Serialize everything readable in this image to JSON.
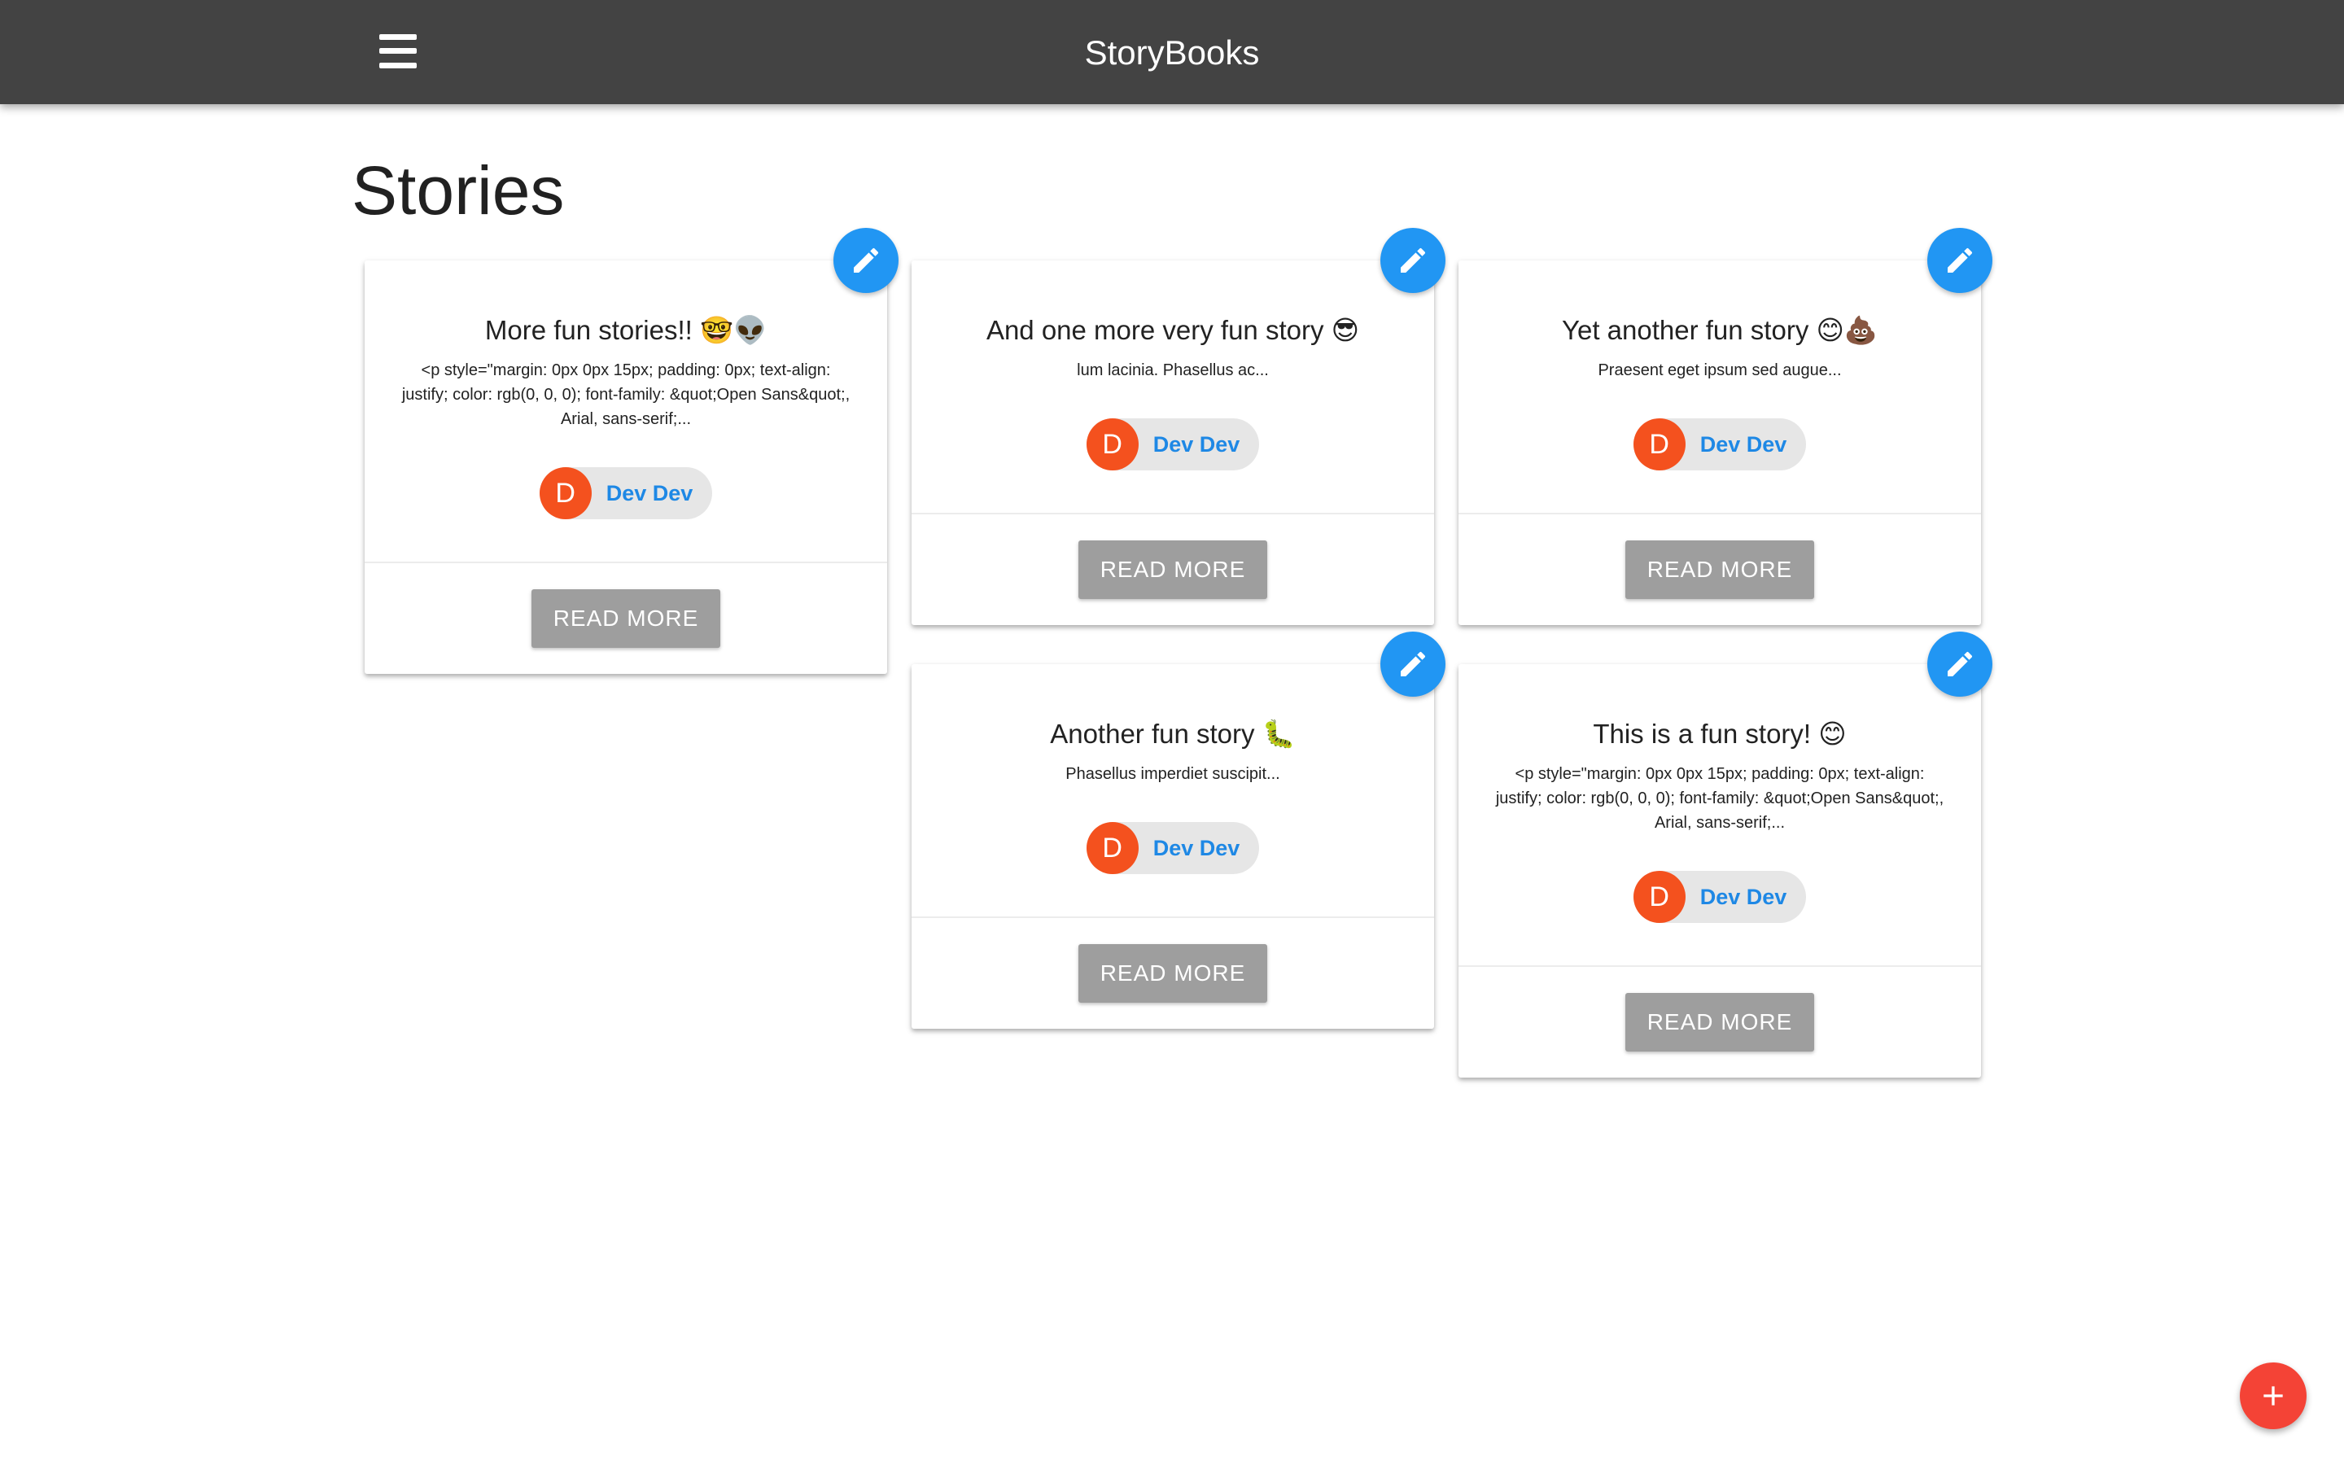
{
  "header": {
    "brand": "StoryBooks",
    "menu_icon": "hamburger-menu-icon"
  },
  "page": {
    "title": "Stories"
  },
  "stories": [
    {
      "title": "More fun stories!! 🤓👽",
      "excerpt": "<p style=\"margin: 0px 0px 15px; padding: 0px; text-align: justify; color: rgb(0, 0, 0); font-family: &quot;Open Sans&quot;, Arial, sans-serif;...",
      "author_initial": "D",
      "author_name": "Dev Dev",
      "read_more_label": "READ MORE",
      "edit_icon": "edit-icon"
    },
    {
      "title": "And one more very fun story 😎",
      "excerpt": "lum lacinia. Phasellus ac...",
      "author_initial": "D",
      "author_name": "Dev Dev",
      "read_more_label": "READ MORE",
      "edit_icon": "edit-icon"
    },
    {
      "title": "Yet another fun story 😊💩",
      "excerpt": "Praesent eget ipsum sed augue...",
      "author_initial": "D",
      "author_name": "Dev Dev",
      "read_more_label": "READ MORE",
      "edit_icon": "edit-icon"
    },
    {
      "title": "Another fun story 🐛",
      "excerpt": "Phasellus imperdiet suscipit...",
      "author_initial": "D",
      "author_name": "Dev Dev",
      "read_more_label": "READ MORE",
      "edit_icon": "edit-icon"
    },
    {
      "title": "This is a fun story! 😊",
      "excerpt": "<p style=\"margin: 0px 0px 15px; padding: 0px; text-align: justify; color: rgb(0, 0, 0); font-family: &quot;Open Sans&quot;, Arial, sans-serif;...",
      "author_initial": "D",
      "author_name": "Dev Dev",
      "read_more_label": "READ MORE",
      "edit_icon": "edit-icon"
    }
  ],
  "fab": {
    "add_icon": "plus-icon"
  },
  "colors": {
    "navbar": "#434343",
    "accent_blue": "#2196f3",
    "link_blue": "#1e88e5",
    "avatar_orange": "#f4511e",
    "add_red": "#f44336",
    "button_grey": "#9e9e9e"
  }
}
